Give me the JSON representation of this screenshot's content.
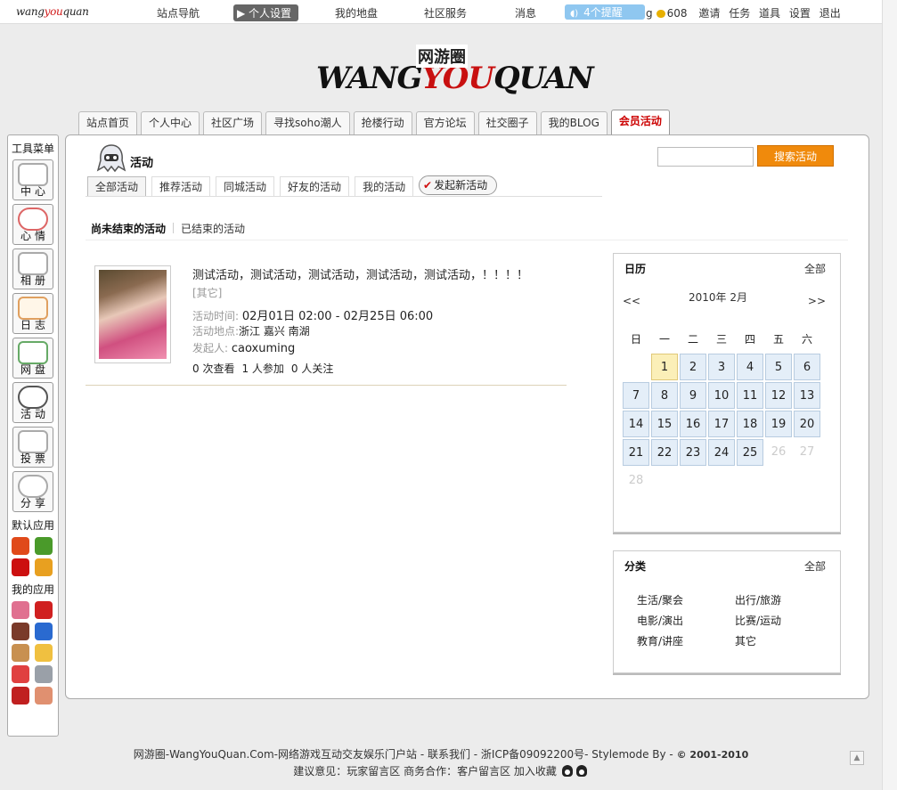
{
  "topbar": {
    "logo_left": "wang",
    "logo_mid": "you",
    "logo_right": "quan",
    "nav": [
      "站点导航",
      "个人设置",
      "我的地盘",
      "社区服务",
      "消息"
    ],
    "reminder": "4个提醒",
    "trailing_g": "g",
    "coins": "608",
    "links": [
      "邀请",
      "任务",
      "道具",
      "设置",
      "退出"
    ]
  },
  "logo": {
    "cn": "网游圈",
    "en_a": "WANG",
    "en_b": "YOU",
    "en_c": "QUAN"
  },
  "main_tabs": [
    "站点首页",
    "个人中心",
    "社区广场",
    "寻找soho潮人",
    "抢楼行动",
    "官方论坛",
    "社交圈子",
    "我的BLOG",
    "会员活动"
  ],
  "toolbar": {
    "title": "工具菜单",
    "items": [
      "中心",
      "心情",
      "相册",
      "日志",
      "网盘",
      "活动",
      "投票",
      "分享"
    ],
    "default_apps_title": "默认应用",
    "my_apps_title": "我的应用"
  },
  "page": {
    "title": "活动",
    "search_button": "搜索活动",
    "search_value": "",
    "sub_tabs": [
      "全部活动",
      "推荐活动",
      "同城活动",
      "好友的活动",
      "我的活动"
    ],
    "new_activity": "发起新活动",
    "filter_active": "尚未结束的活动",
    "filter_other": "已结束的活动"
  },
  "activity": {
    "title": "测试活动，测试活动，测试活动，测试活动，测试活动，！！！！",
    "tag": "[其它]",
    "time_label": "活动时间:",
    "time_value": "02月01日 02:00 - 02月25日 06:00",
    "place_label": "活动地点:",
    "place_value": "浙江 嘉兴 南湖",
    "organizer_label": "发起人:",
    "organizer_value": "caoxuming",
    "views": "0 次查看",
    "joins": "1 人参加",
    "follows": "0 人关注"
  },
  "calendar": {
    "title": "日历",
    "all_link": "全部",
    "prev": "<<",
    "next": ">>",
    "month": "2010年 2月",
    "weekdays": [
      "日",
      "一",
      "二",
      "三",
      "四",
      "五",
      "六"
    ],
    "today": 1,
    "active_days_through": 25,
    "days_in_month": 28
  },
  "categories": {
    "title": "分类",
    "all_link": "全部",
    "items": [
      "生活/聚会",
      "出行/旅游",
      "电影/演出",
      "比赛/运动",
      "教育/讲座",
      "其它"
    ]
  },
  "footer": {
    "line1_text": "网游圈-WangYouQuan.Com-网络游戏互动交友娱乐门户站 - 联系我们 - 浙ICP备09092200号- Stylemode By -",
    "line1_copy": "© 2001-2010",
    "line2": "建议意见：玩家留言区 商务合作：客户留言区 加入收藏"
  },
  "colors": {
    "accent_orange": "#f08a0c",
    "active_tab_red": "#cc0000",
    "reminder_blue": "#8fc7f0",
    "calendar_cell": "#e4eef8",
    "today_cell": "#fbefb8"
  }
}
